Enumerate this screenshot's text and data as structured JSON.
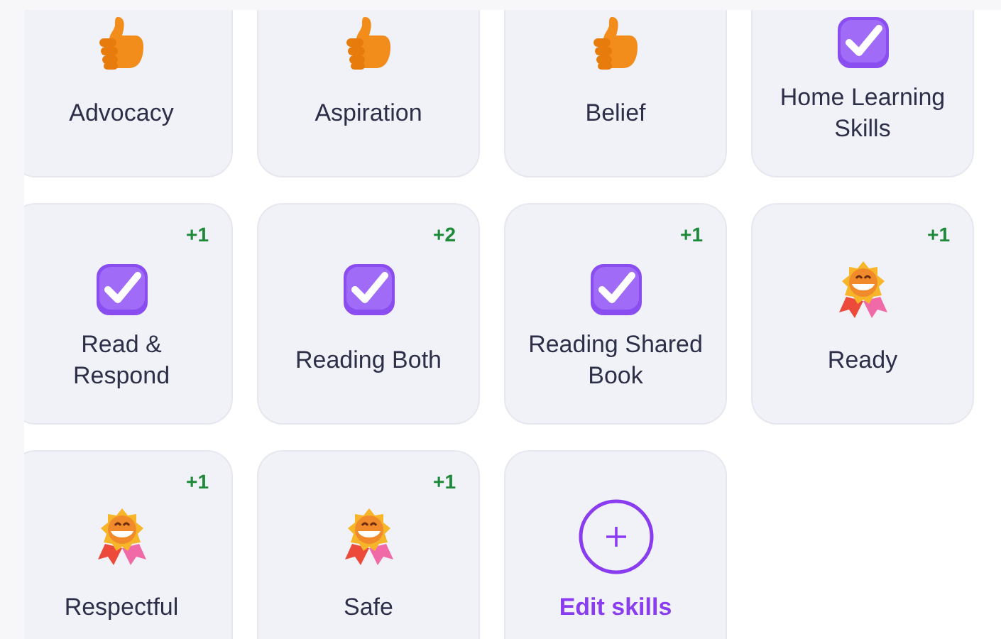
{
  "skills": [
    {
      "label": "Advocacy",
      "kind": "thumbs"
    },
    {
      "label": "Aspiration",
      "kind": "thumbs"
    },
    {
      "label": "Belief",
      "kind": "thumbs"
    },
    {
      "label": "Home Learning Skills",
      "kind": "check"
    },
    {
      "label": "Read & Respond",
      "kind": "check",
      "badge": "+1"
    },
    {
      "label": "Reading Both",
      "kind": "check",
      "badge": "+2"
    },
    {
      "label": "Reading Shared Book",
      "kind": "check",
      "badge": "+1"
    },
    {
      "label": "Ready",
      "kind": "medal",
      "badge": "+1"
    },
    {
      "label": "Respectful",
      "kind": "medal",
      "badge": "+1"
    },
    {
      "label": "Safe",
      "kind": "medal",
      "badge": "+1"
    },
    {
      "label": "Edit skills",
      "kind": "add"
    }
  ]
}
